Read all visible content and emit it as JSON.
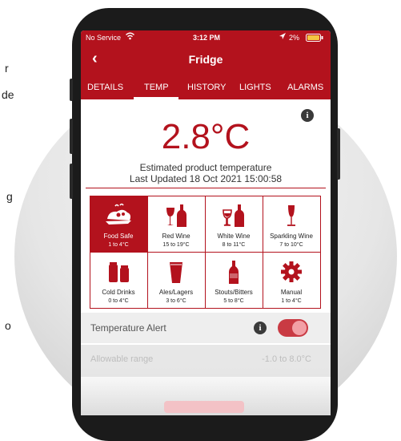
{
  "side_text": [
    "r",
    "de",
    "g",
    "o"
  ],
  "status_bar": {
    "carrier": "No Service",
    "time": "3:12 PM",
    "battery": "2%"
  },
  "nav": {
    "back_glyph": "‹",
    "title": "Fridge"
  },
  "tabs": [
    {
      "label": "DETAILS",
      "active": false
    },
    {
      "label": "TEMP",
      "active": true
    },
    {
      "label": "HISTORY",
      "active": false
    },
    {
      "label": "LIGHTS",
      "active": false
    },
    {
      "label": "ALARMS",
      "active": false
    }
  ],
  "reading": {
    "temperature": "2.8°C",
    "caption": "Estimated product temperature",
    "last_updated": "Last Updated 18 Oct 2021 15:00:58"
  },
  "modes": [
    {
      "name": "Food Safe",
      "range": "1 to 4°C",
      "icon": "food-icon",
      "active": true
    },
    {
      "name": "Red Wine",
      "range": "15 to 19°C",
      "icon": "red-wine-icon",
      "active": false
    },
    {
      "name": "White Wine",
      "range": "8 to 11°C",
      "icon": "white-wine-icon",
      "active": false
    },
    {
      "name": "Sparkling Wine",
      "range": "7 to 10°C",
      "icon": "sparkling-wine-icon",
      "active": false
    },
    {
      "name": "Cold Drinks",
      "range": "0 to 4°C",
      "icon": "cold-drinks-icon",
      "active": false
    },
    {
      "name": "Ales/Lagers",
      "range": "3 to 6°C",
      "icon": "beer-glass-icon",
      "active": false
    },
    {
      "name": "Stouts/Bitters",
      "range": "5 to 8°C",
      "icon": "stout-bottle-icon",
      "active": false
    },
    {
      "name": "Manual",
      "range": "1 to 4°C",
      "icon": "gear-icon",
      "active": false
    }
  ],
  "alert": {
    "label": "Temperature Alert",
    "enabled": true
  },
  "allowable": {
    "label": "Allowable range",
    "value": "-1.0 to 8.0°C"
  },
  "colors": {
    "brand_red": "#b3121d",
    "toggle_on": "#c93a43"
  }
}
